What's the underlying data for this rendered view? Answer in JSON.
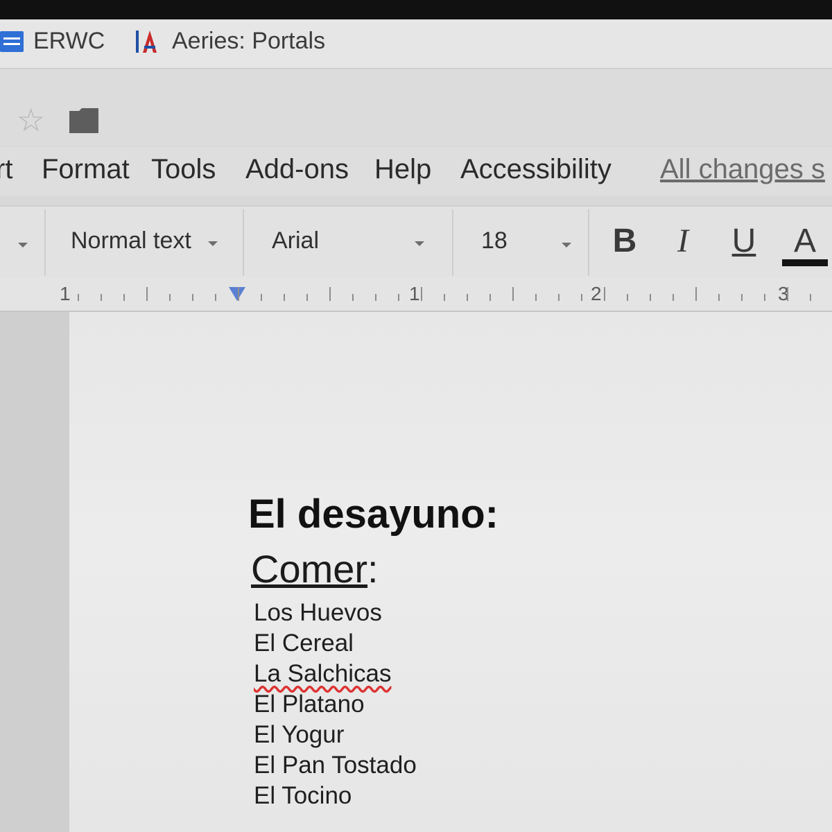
{
  "bookmarks": [
    {
      "label": "ERWC",
      "icon": "google-forms-icon"
    },
    {
      "label": "Aeries: Portals",
      "icon": "aeries-logo-icon"
    }
  ],
  "doc_header": {
    "icons": [
      "star-icon",
      "folder-icon"
    ]
  },
  "menu": {
    "partial_insert": "rt",
    "items": [
      "Format",
      "Tools",
      "Add-ons",
      "Help",
      "Accessibility"
    ],
    "save_status": "All changes s"
  },
  "toolbar": {
    "style": "Normal text",
    "font": "Arial",
    "size": "18",
    "bold": "B",
    "italic": "I",
    "underline": "U",
    "text_color": "A",
    "text_color_swatch": "#141414"
  },
  "ruler": {
    "labels": [
      "1",
      "1",
      "2",
      "3"
    ]
  },
  "document": {
    "title": "El desayuno:",
    "subtitle_word": "Comer",
    "subtitle_punct": ":",
    "items": [
      "Los Huevos",
      "El Cereal",
      "La Salchicas",
      "El Platano",
      "El Yogur",
      "El Pan Tostado",
      "El Tocino"
    ]
  }
}
